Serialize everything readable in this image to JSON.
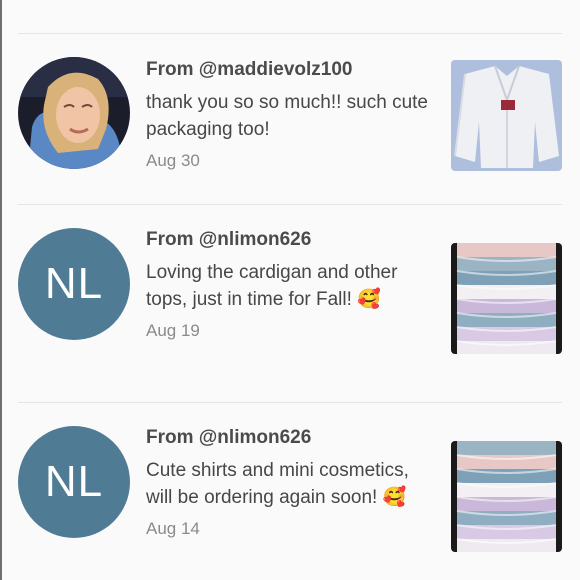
{
  "reviews": [
    {
      "from": "From @maddievolz100",
      "message": "thank you so so much!! such cute packaging too!",
      "date": "Aug 30",
      "avatar_initials": "",
      "emoji": ""
    },
    {
      "from": "From @nlimon626",
      "message": "Loving the cardigan and other tops, just in time for Fall!",
      "date": "Aug 19",
      "avatar_initials": "NL",
      "emoji": "🥰"
    },
    {
      "from": "From @nlimon626",
      "message": "Cute shirts and mini cosmetics, will be ordering again soon!",
      "date": "Aug 14",
      "avatar_initials": "NL",
      "emoji": "🥰"
    }
  ],
  "colors": {
    "avatar_bg": "#4f7c94",
    "background": "#fbfafb"
  },
  "icons": {
    "reaction": "smiling-face-with-hearts-icon"
  }
}
